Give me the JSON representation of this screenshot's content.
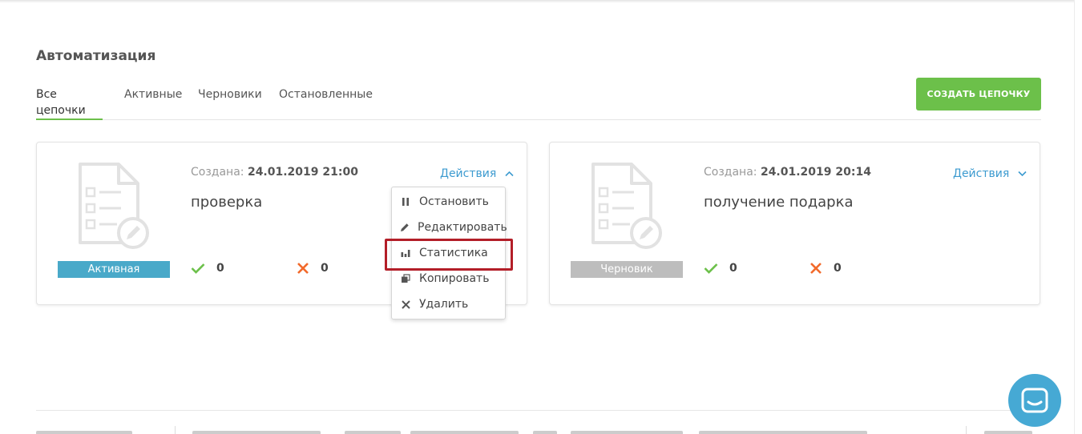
{
  "page": {
    "title": "Автоматизация"
  },
  "tabs": [
    {
      "label": "Все цепочки"
    },
    {
      "label": "Активные"
    },
    {
      "label": "Черновики"
    },
    {
      "label": "Остановленные"
    }
  ],
  "create_button": {
    "label": "СОЗДАТЬ ЦЕПОЧКУ"
  },
  "cards": [
    {
      "created_label": "Создана:",
      "created_value": "24.01.2019 21:00",
      "name": "проверка",
      "status": "Активная",
      "status_color": "#49a9c9",
      "actions_label": "Действия",
      "success_count": "0",
      "error_count": "0"
    },
    {
      "created_label": "Создана:",
      "created_value": "24.01.2019 20:14",
      "name": "получение подарка",
      "status": "Черновик",
      "status_color": "#bdbdbd",
      "actions_label": "Действия",
      "success_count": "0",
      "error_count": "0"
    }
  ],
  "actions_menu": {
    "items": [
      {
        "label": "Остановить",
        "icon": "pause-icon"
      },
      {
        "label": "Редактировать",
        "icon": "pencil-icon"
      },
      {
        "label": "Статистика",
        "icon": "bar-chart-icon"
      },
      {
        "label": "Копировать",
        "icon": "copy-icon"
      },
      {
        "label": "Удалить",
        "icon": "close-icon"
      }
    ]
  },
  "colors": {
    "accent_green": "#6cc04a",
    "link_blue": "#3d9bd0",
    "success_green": "#6cc04a",
    "error_orange": "#f26a2b",
    "highlight_red": "#b31e28",
    "chat_blue": "#46a9d4"
  }
}
